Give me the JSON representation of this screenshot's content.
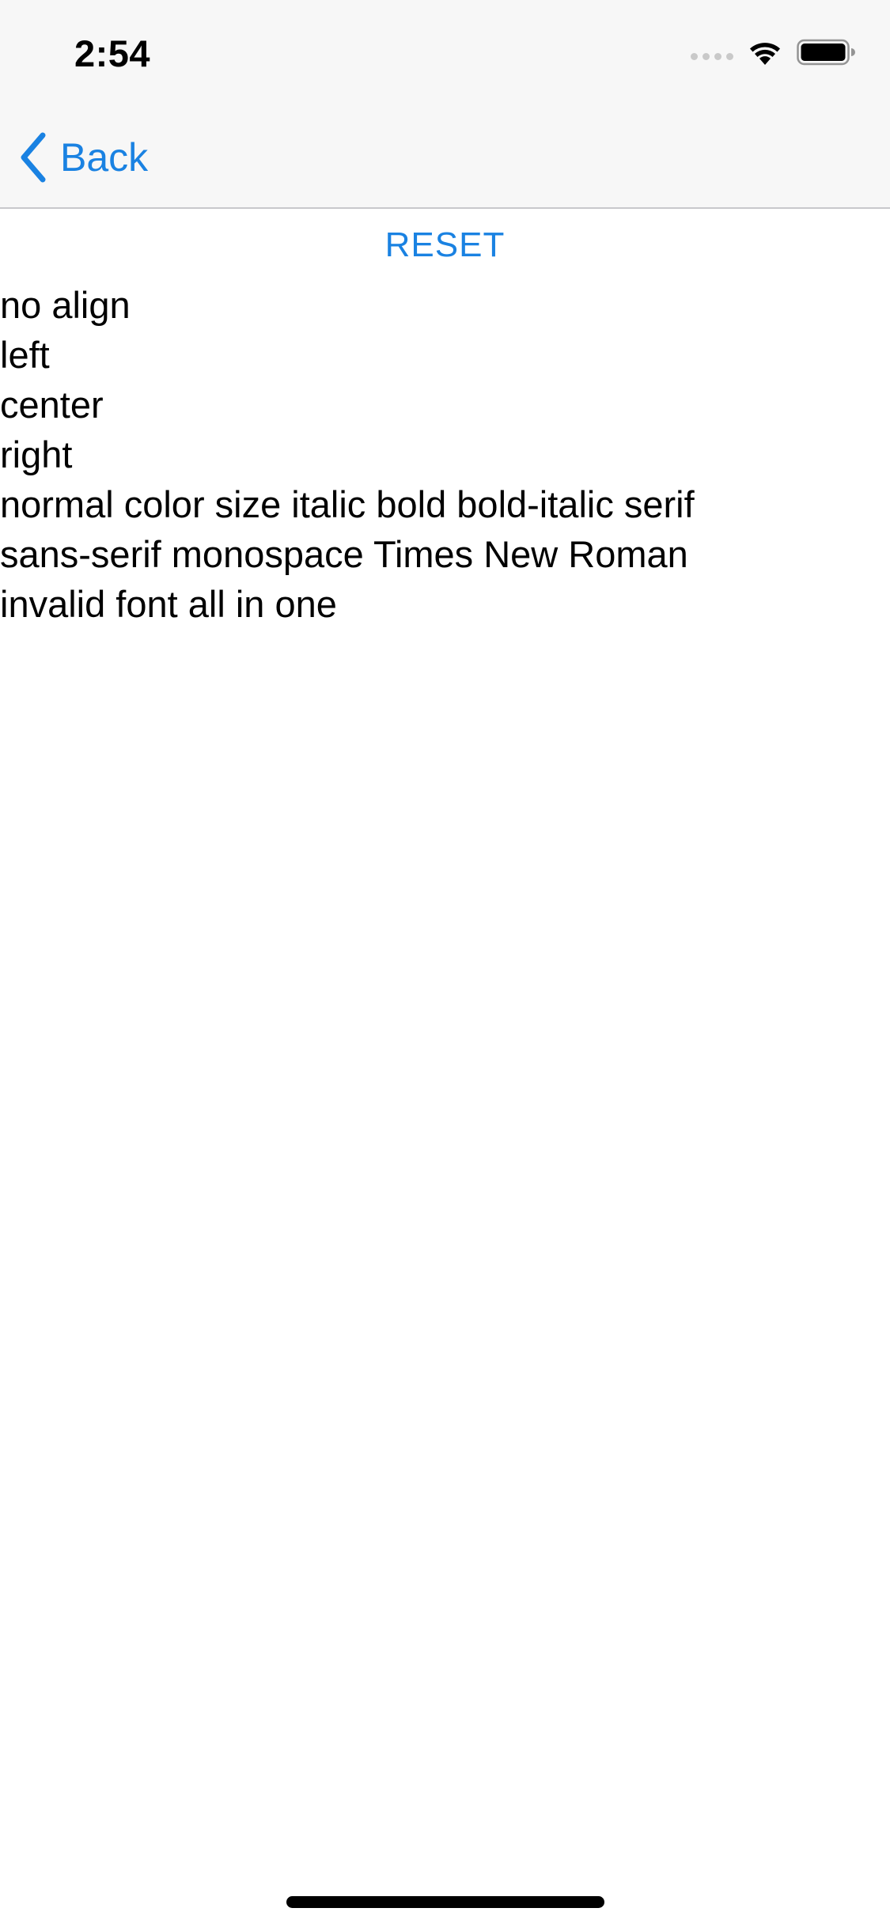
{
  "status_bar": {
    "time": "2:54",
    "signal_icon": "cellular-signal-icon",
    "wifi_icon": "wifi-icon",
    "battery_icon": "battery-icon"
  },
  "nav": {
    "back_label": "Back",
    "back_icon": "chevron-left-icon"
  },
  "content": {
    "reset_label": "RESET",
    "lines": [
      "no align",
      "left",
      "center",
      "right",
      "normal color size italic bold bold-italic serif",
      "sans-serif monospace Times New Roman",
      "invalid font all in one"
    ]
  },
  "colors": {
    "accent": "#1a82e2",
    "text": "#000000",
    "chrome_bg": "#f7f7f7",
    "separator": "#c8c8cc"
  }
}
